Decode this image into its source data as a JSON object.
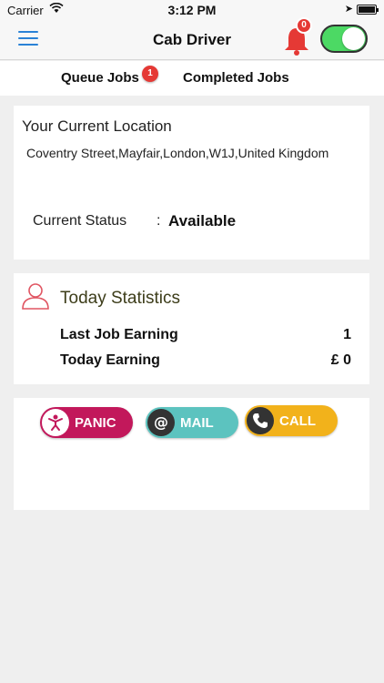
{
  "status_bar": {
    "carrier": "Carrier",
    "time": "3:12 PM"
  },
  "nav": {
    "title": "Cab Driver",
    "notification_count": "0",
    "online_toggle": true
  },
  "tabs": {
    "queue": {
      "label": "Queue Jobs",
      "badge": "1"
    },
    "completed": {
      "label": "Completed Jobs"
    }
  },
  "location_card": {
    "title": "Your Current Location",
    "address": "Coventry Street,Mayfair,London,W1J,United Kingdom",
    "status_label": "Current Status",
    "status_separator": ":",
    "status_value": "Available"
  },
  "stats_card": {
    "title": "Today Statistics",
    "rows": [
      {
        "label": "Last Job Earning",
        "value": "1"
      },
      {
        "label": "Today Earning",
        "value": "£ 0"
      }
    ]
  },
  "actions": {
    "panic": "PANIC",
    "mail": "MAIL",
    "call": "CALL"
  },
  "colors": {
    "accent": "#2a82d6",
    "toggle_on": "#4cd964",
    "badge": "#e53935",
    "panic": "#c2185b",
    "mail": "#5cc3bf",
    "call": "#f2b21b"
  }
}
